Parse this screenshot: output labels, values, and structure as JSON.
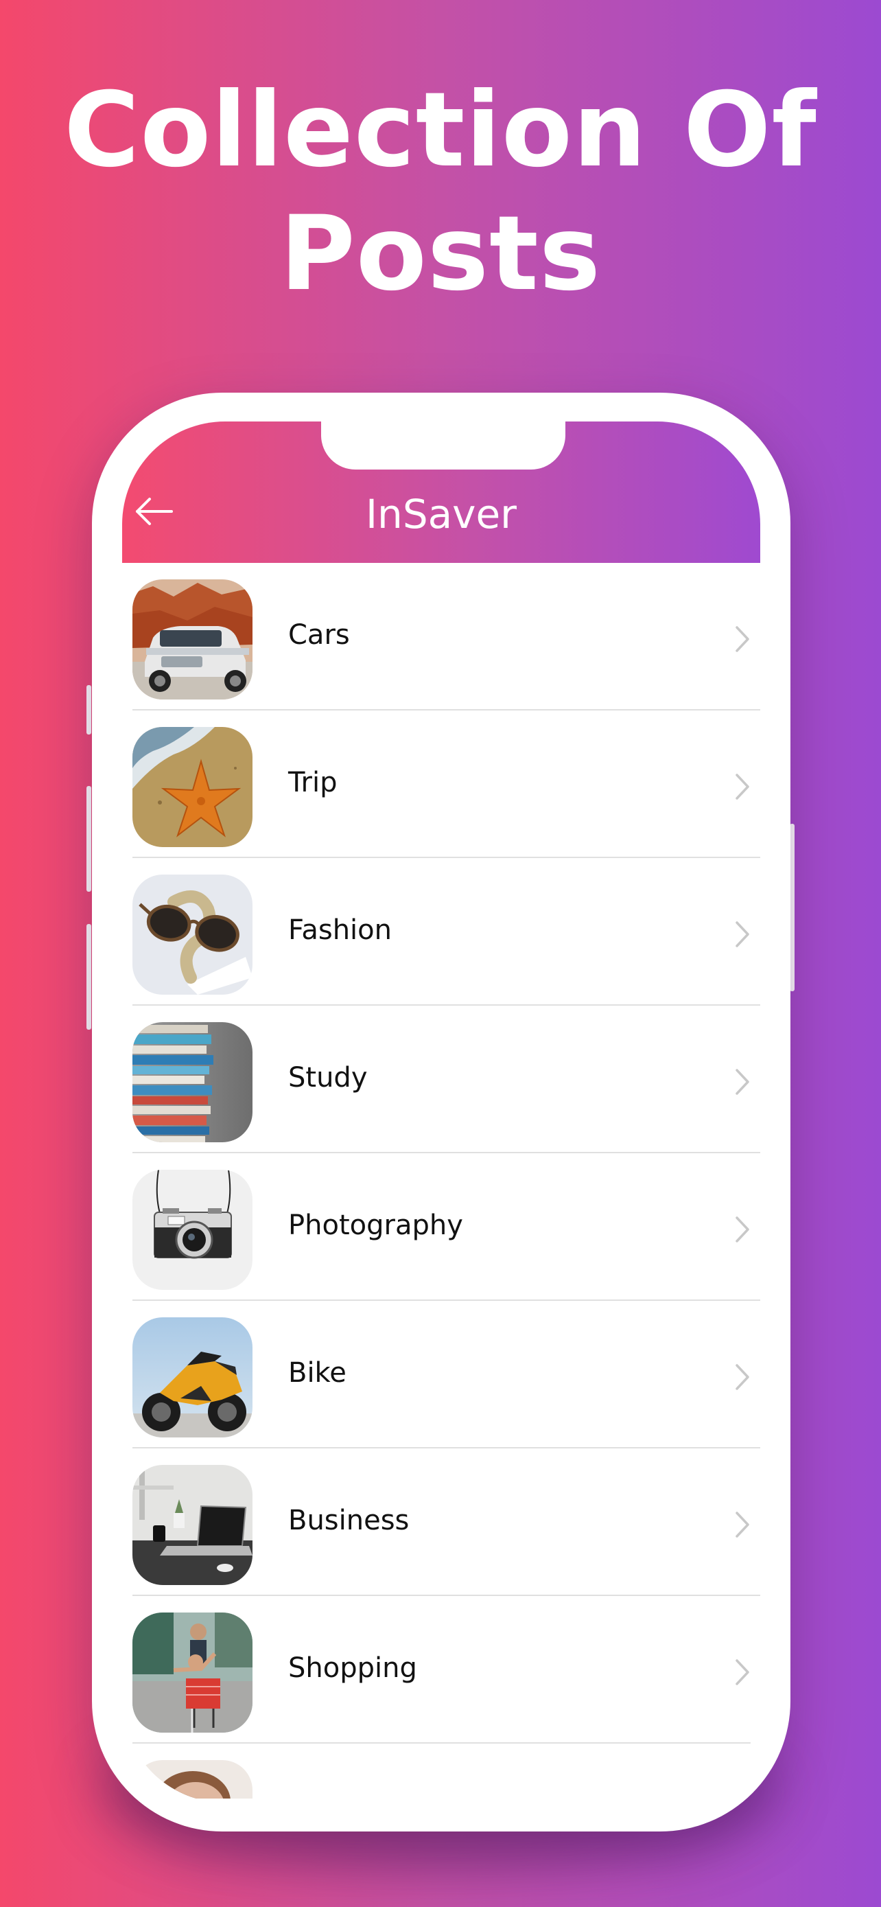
{
  "promo": {
    "title_line1": "Collection Of",
    "title_line2": "Posts"
  },
  "app": {
    "title": "InSaver",
    "back_icon": "arrow-left-icon"
  },
  "categories": [
    {
      "label": "Cars",
      "icon": "car-thumbnail"
    },
    {
      "label": "Trip",
      "icon": "starfish-thumbnail"
    },
    {
      "label": "Fashion",
      "icon": "sunglasses-thumbnail"
    },
    {
      "label": "Study",
      "icon": "books-thumbnail"
    },
    {
      "label": "Photography",
      "icon": "camera-thumbnail"
    },
    {
      "label": "Bike",
      "icon": "motorbike-thumbnail"
    },
    {
      "label": "Business",
      "icon": "laptop-thumbnail"
    },
    {
      "label": "Shopping",
      "icon": "shopping-cart-thumbnail"
    }
  ],
  "colors": {
    "gradient_start": "#f4486b",
    "gradient_end": "#9c4ad1",
    "chevron": "#c8c8c8",
    "divider": "#e0e0e0"
  }
}
